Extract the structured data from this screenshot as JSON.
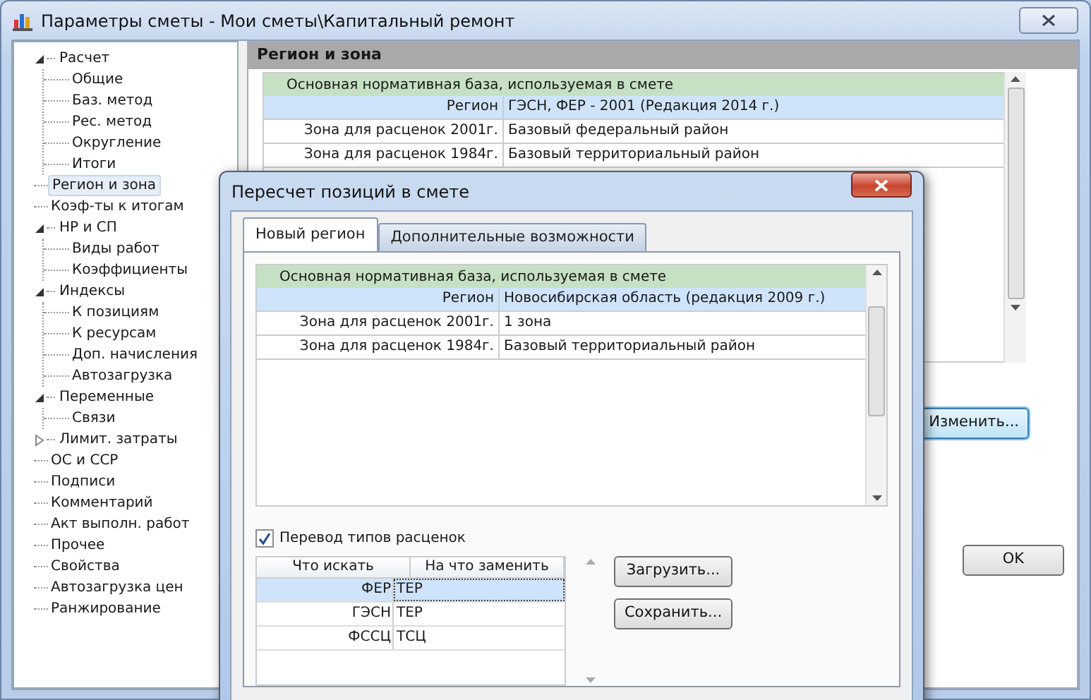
{
  "window": {
    "title": "Параметры сметы - Мои сметы\\Капитальный ремонт"
  },
  "tree": [
    {
      "label": "Расчет",
      "expanded": true,
      "selected": false,
      "children": [
        {
          "label": "Общие",
          "selected": false
        },
        {
          "label": "Баз. метод",
          "selected": false
        },
        {
          "label": "Рес. метод",
          "selected": false
        },
        {
          "label": "Округление",
          "selected": false
        },
        {
          "label": "Итоги",
          "selected": false
        }
      ]
    },
    {
      "label": "Регион и зона",
      "selected": true
    },
    {
      "label": "Коэф-ты к итогам",
      "selected": false
    },
    {
      "label": "НР и СП",
      "expanded": true,
      "selected": false,
      "children": [
        {
          "label": "Виды работ",
          "selected": false
        },
        {
          "label": "Коэффициенты",
          "selected": false
        }
      ]
    },
    {
      "label": "Индексы",
      "expanded": true,
      "selected": false,
      "children": [
        {
          "label": "К позициям",
          "selected": false
        },
        {
          "label": "К ресурсам",
          "selected": false
        },
        {
          "label": "Доп. начисления",
          "selected": false
        },
        {
          "label": "Автозагрузка",
          "selected": false
        }
      ]
    },
    {
      "label": "Переменные",
      "expanded": true,
      "selected": false,
      "children": [
        {
          "label": "Связи",
          "selected": false
        }
      ]
    },
    {
      "label": "Лимит. затраты",
      "expanded": false,
      "selected": false
    },
    {
      "label": "ОС и ССР",
      "selected": false
    },
    {
      "label": "Подписи",
      "selected": false
    },
    {
      "label": "Комментарий",
      "selected": false
    },
    {
      "label": "Акт выполн. работ",
      "selected": false
    },
    {
      "label": "Прочее",
      "selected": false
    },
    {
      "label": "Свойства",
      "selected": false
    },
    {
      "label": "Автозагрузка цен",
      "selected": false
    },
    {
      "label": "Ранжирование",
      "selected": false
    }
  ],
  "panel": {
    "title": "Регион и зона",
    "table": {
      "group": "Основная нормативная база, используемая в смете",
      "rows": [
        {
          "label": "Регион",
          "value": "ГЭСН, ФЕР - 2001 (Редакция 2014 г.)",
          "selected": true
        },
        {
          "label": "Зона для расценок 2001г.",
          "value": "Базовый федеральный район",
          "selected": false
        },
        {
          "label": "Зона для расценок 1984г.",
          "value": "Базовый территориальный район",
          "selected": false
        }
      ]
    },
    "button": "Изменить..."
  },
  "footer_button": "OK",
  "dialog": {
    "title": "Пересчет позиций в смете",
    "tabs": [
      {
        "label": "Новый регион",
        "selected": true
      },
      {
        "label": "Дополнительные возможности",
        "selected": false
      }
    ],
    "table": {
      "group": "Основная нормативная база, используемая в смете",
      "rows": [
        {
          "label": "Регион",
          "value": "Новосибирская область (редакция 2009 г.)",
          "selected": true
        },
        {
          "label": "Зона для расценок 2001г.",
          "value": "1 зона",
          "selected": false
        },
        {
          "label": "Зона для расценок 1984г.",
          "value": "Базовый территориальный район",
          "selected": false
        }
      ]
    },
    "convert": {
      "label": "Перевод типов расценок",
      "checked": true
    },
    "mapping": {
      "columns": [
        "Что искать",
        "На что заменить"
      ],
      "rows": [
        {
          "find": "ФЕР",
          "replace": "ТЕР",
          "selected": true
        },
        {
          "find": "ГЭСН",
          "replace": "ТЕР",
          "selected": false
        },
        {
          "find": "ФССЦ",
          "replace": "ТСЦ",
          "selected": false
        }
      ]
    },
    "buttons": [
      "Загрузить...",
      "Сохранить..."
    ]
  }
}
